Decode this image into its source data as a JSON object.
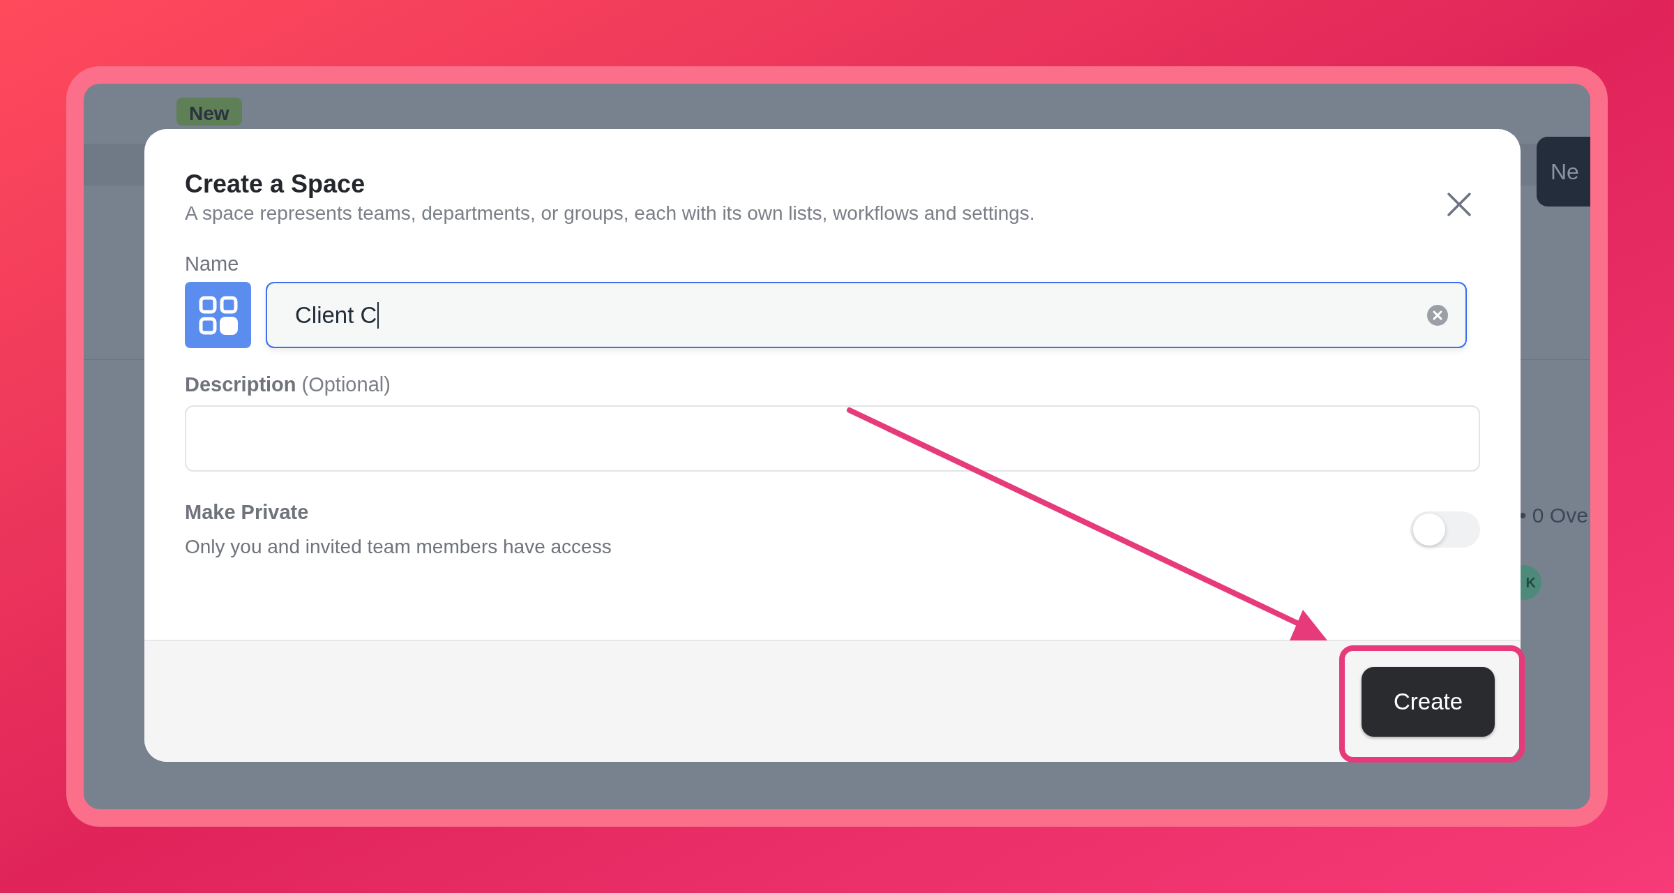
{
  "background_app": {
    "badge": "New",
    "button": "Ne",
    "stat": "• 0 Ove",
    "avatar": "K"
  },
  "dialog": {
    "title": "Create a Space",
    "subtitle": "A space represents teams, departments, or groups, each with its own lists, workflows and settings.",
    "name_label": "Name",
    "name_value": "Client C",
    "description_label": "Description",
    "description_note": "(Optional)",
    "private_title": "Make Private",
    "private_text": "Only you and invited team members have access",
    "private_on": false,
    "create_button": "Create"
  }
}
